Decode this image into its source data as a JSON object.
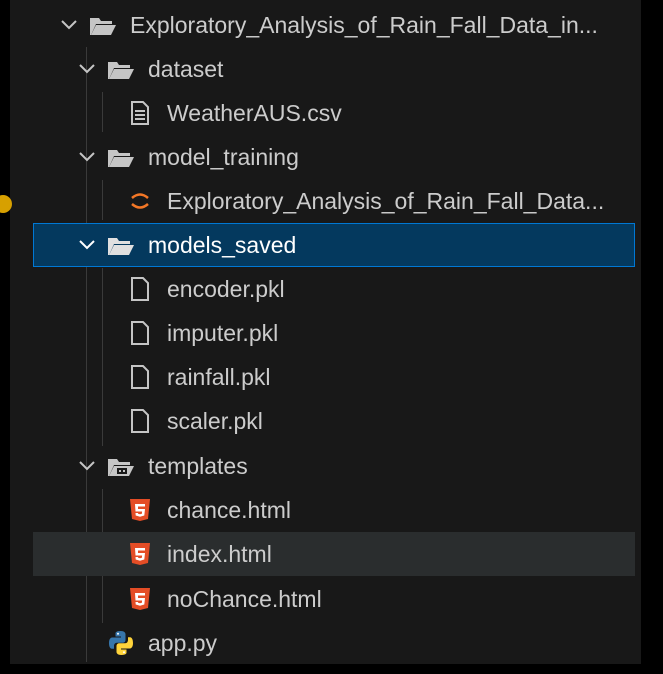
{
  "colors": {
    "background": "#181818",
    "text": "#cccccc",
    "selected_bg": "#04395e",
    "selected_border": "#0078d4",
    "folder_icon": "#c5c5c5",
    "html_icon": "#e44d26",
    "jupyter_icon": "#f37726",
    "python_blue": "#3776ab",
    "python_yellow": "#ffd43b"
  },
  "tree": {
    "root": {
      "label": "Exploratory_Analysis_of_Rain_Fall_Data_in...",
      "icon": "folder-open-icon"
    },
    "dataset": {
      "label": "dataset",
      "icon": "folder-open-icon"
    },
    "weather_csv": {
      "label": "WeatherAUS.csv",
      "icon": "csv-file-icon"
    },
    "model_training": {
      "label": "model_training",
      "icon": "folder-open-icon"
    },
    "notebook": {
      "label": "Exploratory_Analysis_of_Rain_Fall_Data...",
      "icon": "jupyter-icon"
    },
    "models_saved": {
      "label": "models_saved",
      "icon": "folder-open-icon"
    },
    "encoder": {
      "label": "encoder.pkl",
      "icon": "file-icon"
    },
    "imputer": {
      "label": "imputer.pkl",
      "icon": "file-icon"
    },
    "rainfall": {
      "label": "rainfall.pkl",
      "icon": "file-icon"
    },
    "scaler": {
      "label": "scaler.pkl",
      "icon": "file-icon"
    },
    "templates": {
      "label": "templates",
      "icon": "templates-folder-icon"
    },
    "chance": {
      "label": "chance.html",
      "icon": "html5-icon"
    },
    "index": {
      "label": "index.html",
      "icon": "html5-icon"
    },
    "nochance": {
      "label": "noChance.html",
      "icon": "html5-icon"
    },
    "app": {
      "label": "app.py",
      "icon": "python-icon"
    }
  }
}
